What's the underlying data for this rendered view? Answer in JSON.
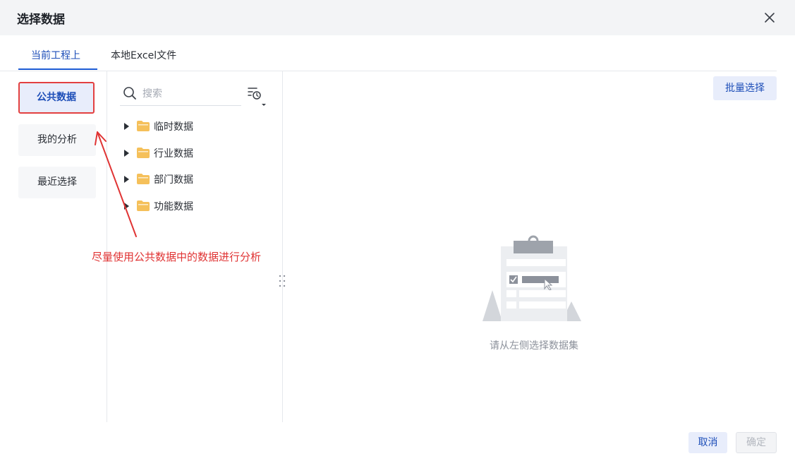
{
  "dialog": {
    "title": "选择数据",
    "close_icon": "close-icon"
  },
  "tabs": [
    {
      "label": "当前工程上",
      "active": true
    },
    {
      "label": "本地Excel文件",
      "active": false
    }
  ],
  "batch_select_label": "批量选择",
  "left_nav": [
    {
      "label": "公共数据",
      "active": true
    },
    {
      "label": "我的分析",
      "active": false
    },
    {
      "label": "最近选择",
      "active": false
    }
  ],
  "search": {
    "placeholder": "搜索",
    "value": "",
    "icon": "search-icon"
  },
  "sort_icon": "sort-history-icon",
  "tree": [
    {
      "label": "临时数据",
      "icon": "folder-icon"
    },
    {
      "label": "行业数据",
      "icon": "folder-icon"
    },
    {
      "label": "部门数据",
      "icon": "folder-icon"
    },
    {
      "label": "功能数据",
      "icon": "folder-icon"
    }
  ],
  "annotation": {
    "text": "尽量使用公共数据中的数据进行分析"
  },
  "empty_state": {
    "text": "请从左侧选择数据集",
    "icon": "clipboard-illustration-icon"
  },
  "footer": {
    "cancel_label": "取消",
    "ok_label": "确定"
  },
  "colors": {
    "accent": "#1d4eb8",
    "annotation": "#e03434",
    "folder": "#f5c05a"
  }
}
